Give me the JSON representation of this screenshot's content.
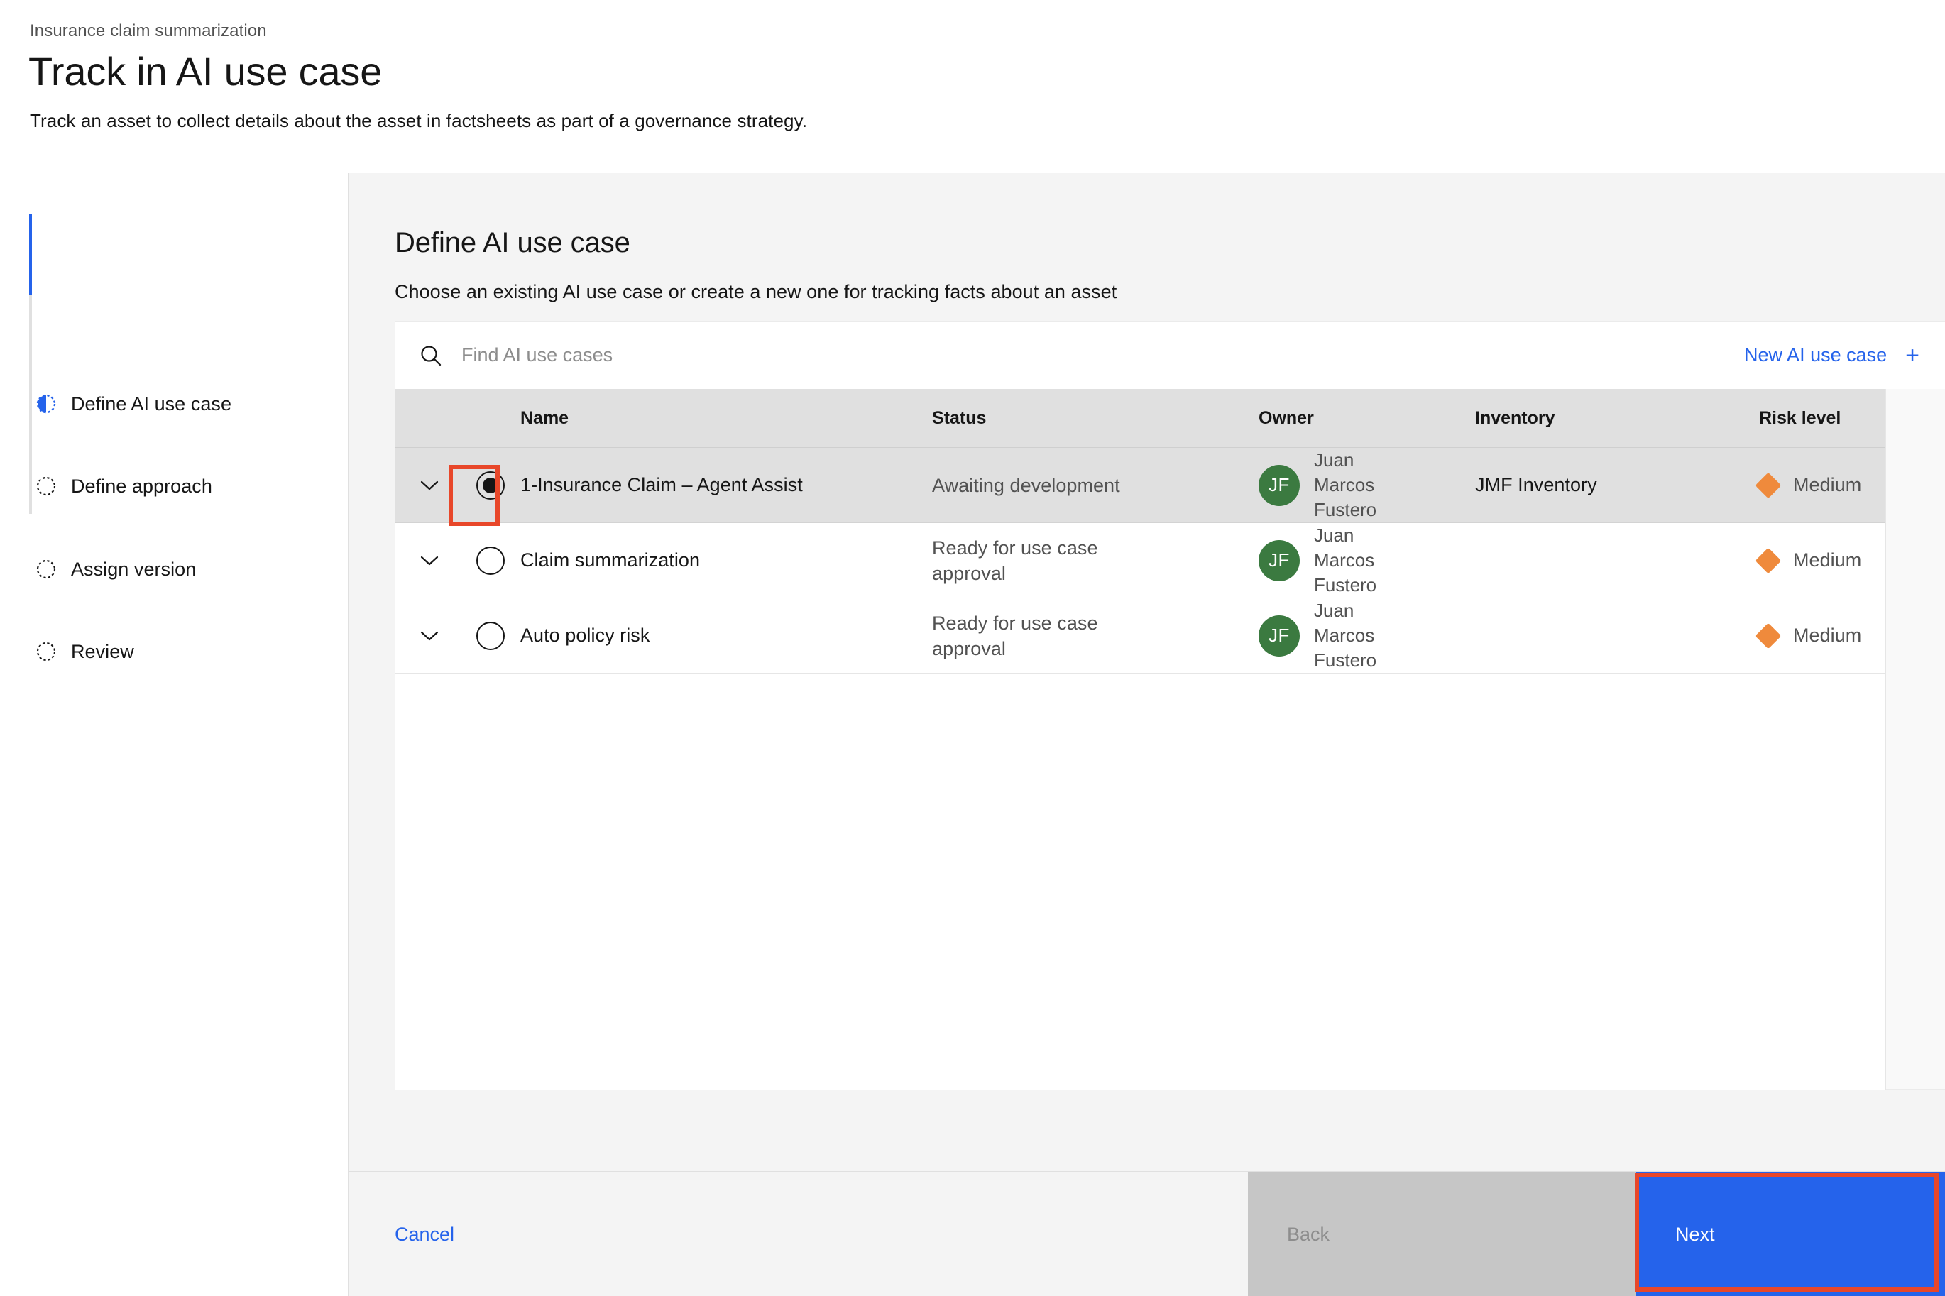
{
  "header": {
    "breadcrumb": "Insurance claim summarization",
    "title": "Track in AI use case",
    "subtitle": "Track an asset to collect details about the asset in factsheets as part of a governance strategy."
  },
  "sidebar": {
    "items": [
      {
        "label": "Define AI use case",
        "state": "current",
        "icon": "half-filled-circle-icon"
      },
      {
        "label": "Define approach",
        "state": "incomplete",
        "icon": "dashed-circle-icon"
      },
      {
        "label": "Assign version",
        "state": "incomplete",
        "icon": "dashed-circle-icon"
      },
      {
        "label": "Review",
        "state": "incomplete",
        "icon": "dashed-circle-icon"
      }
    ]
  },
  "main": {
    "step_title": "Define AI use case",
    "step_description": "Choose an existing AI use case or create a new one for tracking facts about an asset",
    "search": {
      "placeholder": "Find AI use cases",
      "value": "",
      "icon": "search-icon"
    },
    "new_use_case": {
      "label": "New AI use case",
      "icon": "plus-icon"
    },
    "table": {
      "columns": [
        "Name",
        "Status",
        "Owner",
        "Inventory",
        "Risk level"
      ],
      "rows": [
        {
          "name": "1-Insurance Claim – Agent Assist",
          "status": "Awaiting development",
          "owner": "Juan Marcos Fustero",
          "owner_initials": "JF",
          "inventory": "JMF Inventory",
          "risk_level": "Medium",
          "selected": true
        },
        {
          "name": "Claim summarization",
          "status": "Ready for use case approval",
          "owner": "Juan Marcos Fustero",
          "owner_initials": "JF",
          "inventory": "",
          "risk_level": "Medium",
          "selected": false
        },
        {
          "name": "Auto policy risk",
          "status": "Ready for use case approval",
          "owner": "Juan Marcos Fustero",
          "owner_initials": "JF",
          "inventory": "",
          "risk_level": "Medium",
          "selected": false
        }
      ]
    }
  },
  "footer": {
    "cancel_label": "Cancel",
    "back_label": "Back",
    "next_label": "Next"
  },
  "colors": {
    "accent_blue": "#2563eb",
    "avatar_green": "#3b7a40",
    "risk_medium_orange": "#ef8a3c",
    "annotation_red": "#e8472a",
    "selected_row_gray": "#e0e0e0"
  }
}
